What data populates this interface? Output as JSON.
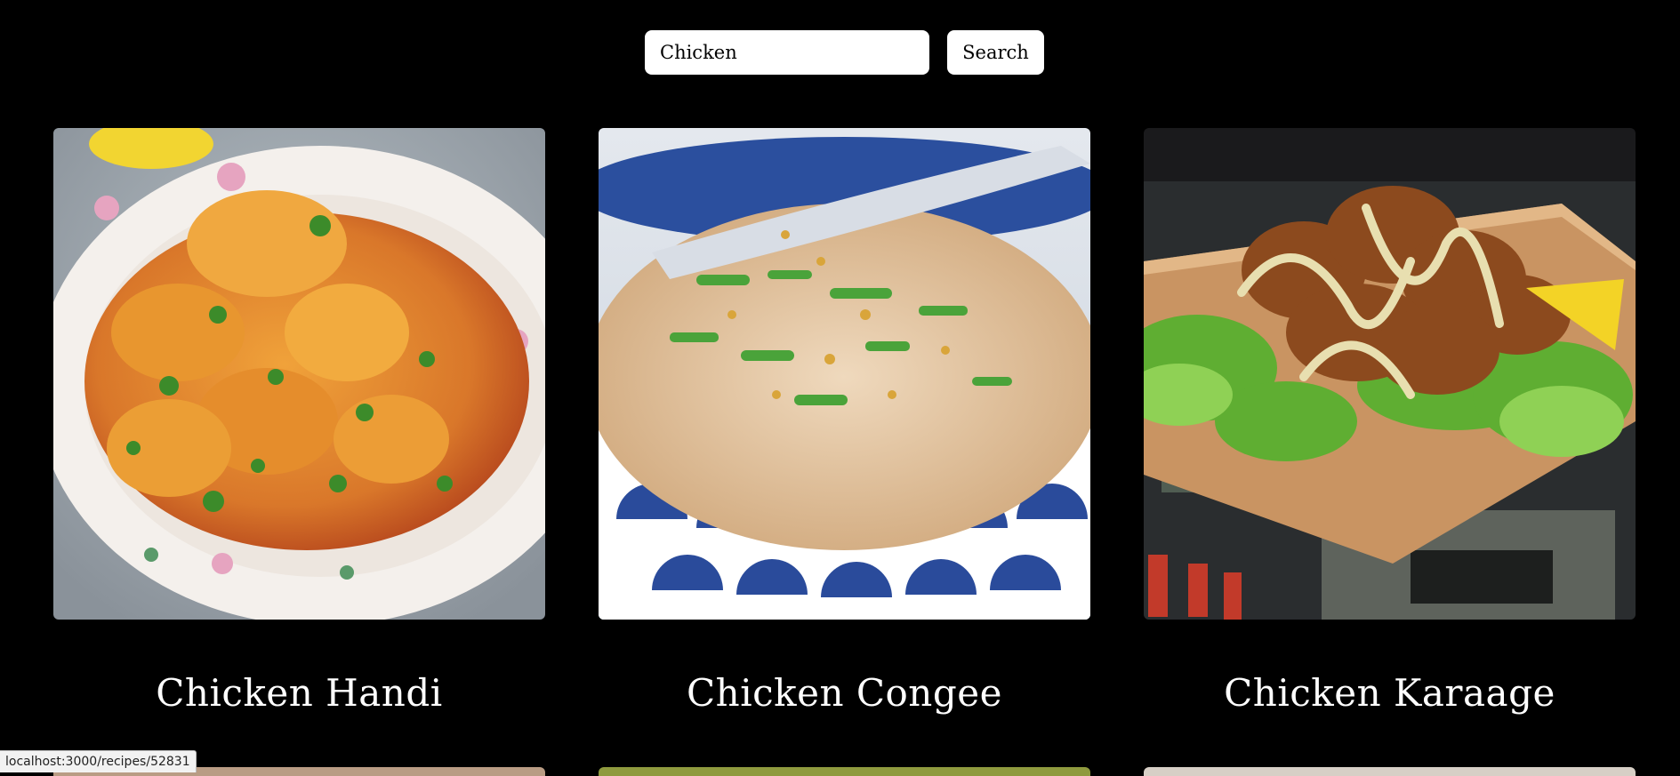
{
  "search": {
    "value": "Chicken",
    "placeholder": "",
    "button_label": "Search"
  },
  "recipes": [
    {
      "title": "Chicken Handi",
      "image": "chicken-handi-photo"
    },
    {
      "title": "Chicken Congee",
      "image": "chicken-congee-photo"
    },
    {
      "title": "Chicken Karaage",
      "image": "chicken-karaage-photo"
    }
  ],
  "status_bar": {
    "url": "localhost:3000/recipes/52831"
  },
  "colors": {
    "background": "#000000",
    "text": "#ffffff",
    "control_bg": "#ffffff"
  }
}
